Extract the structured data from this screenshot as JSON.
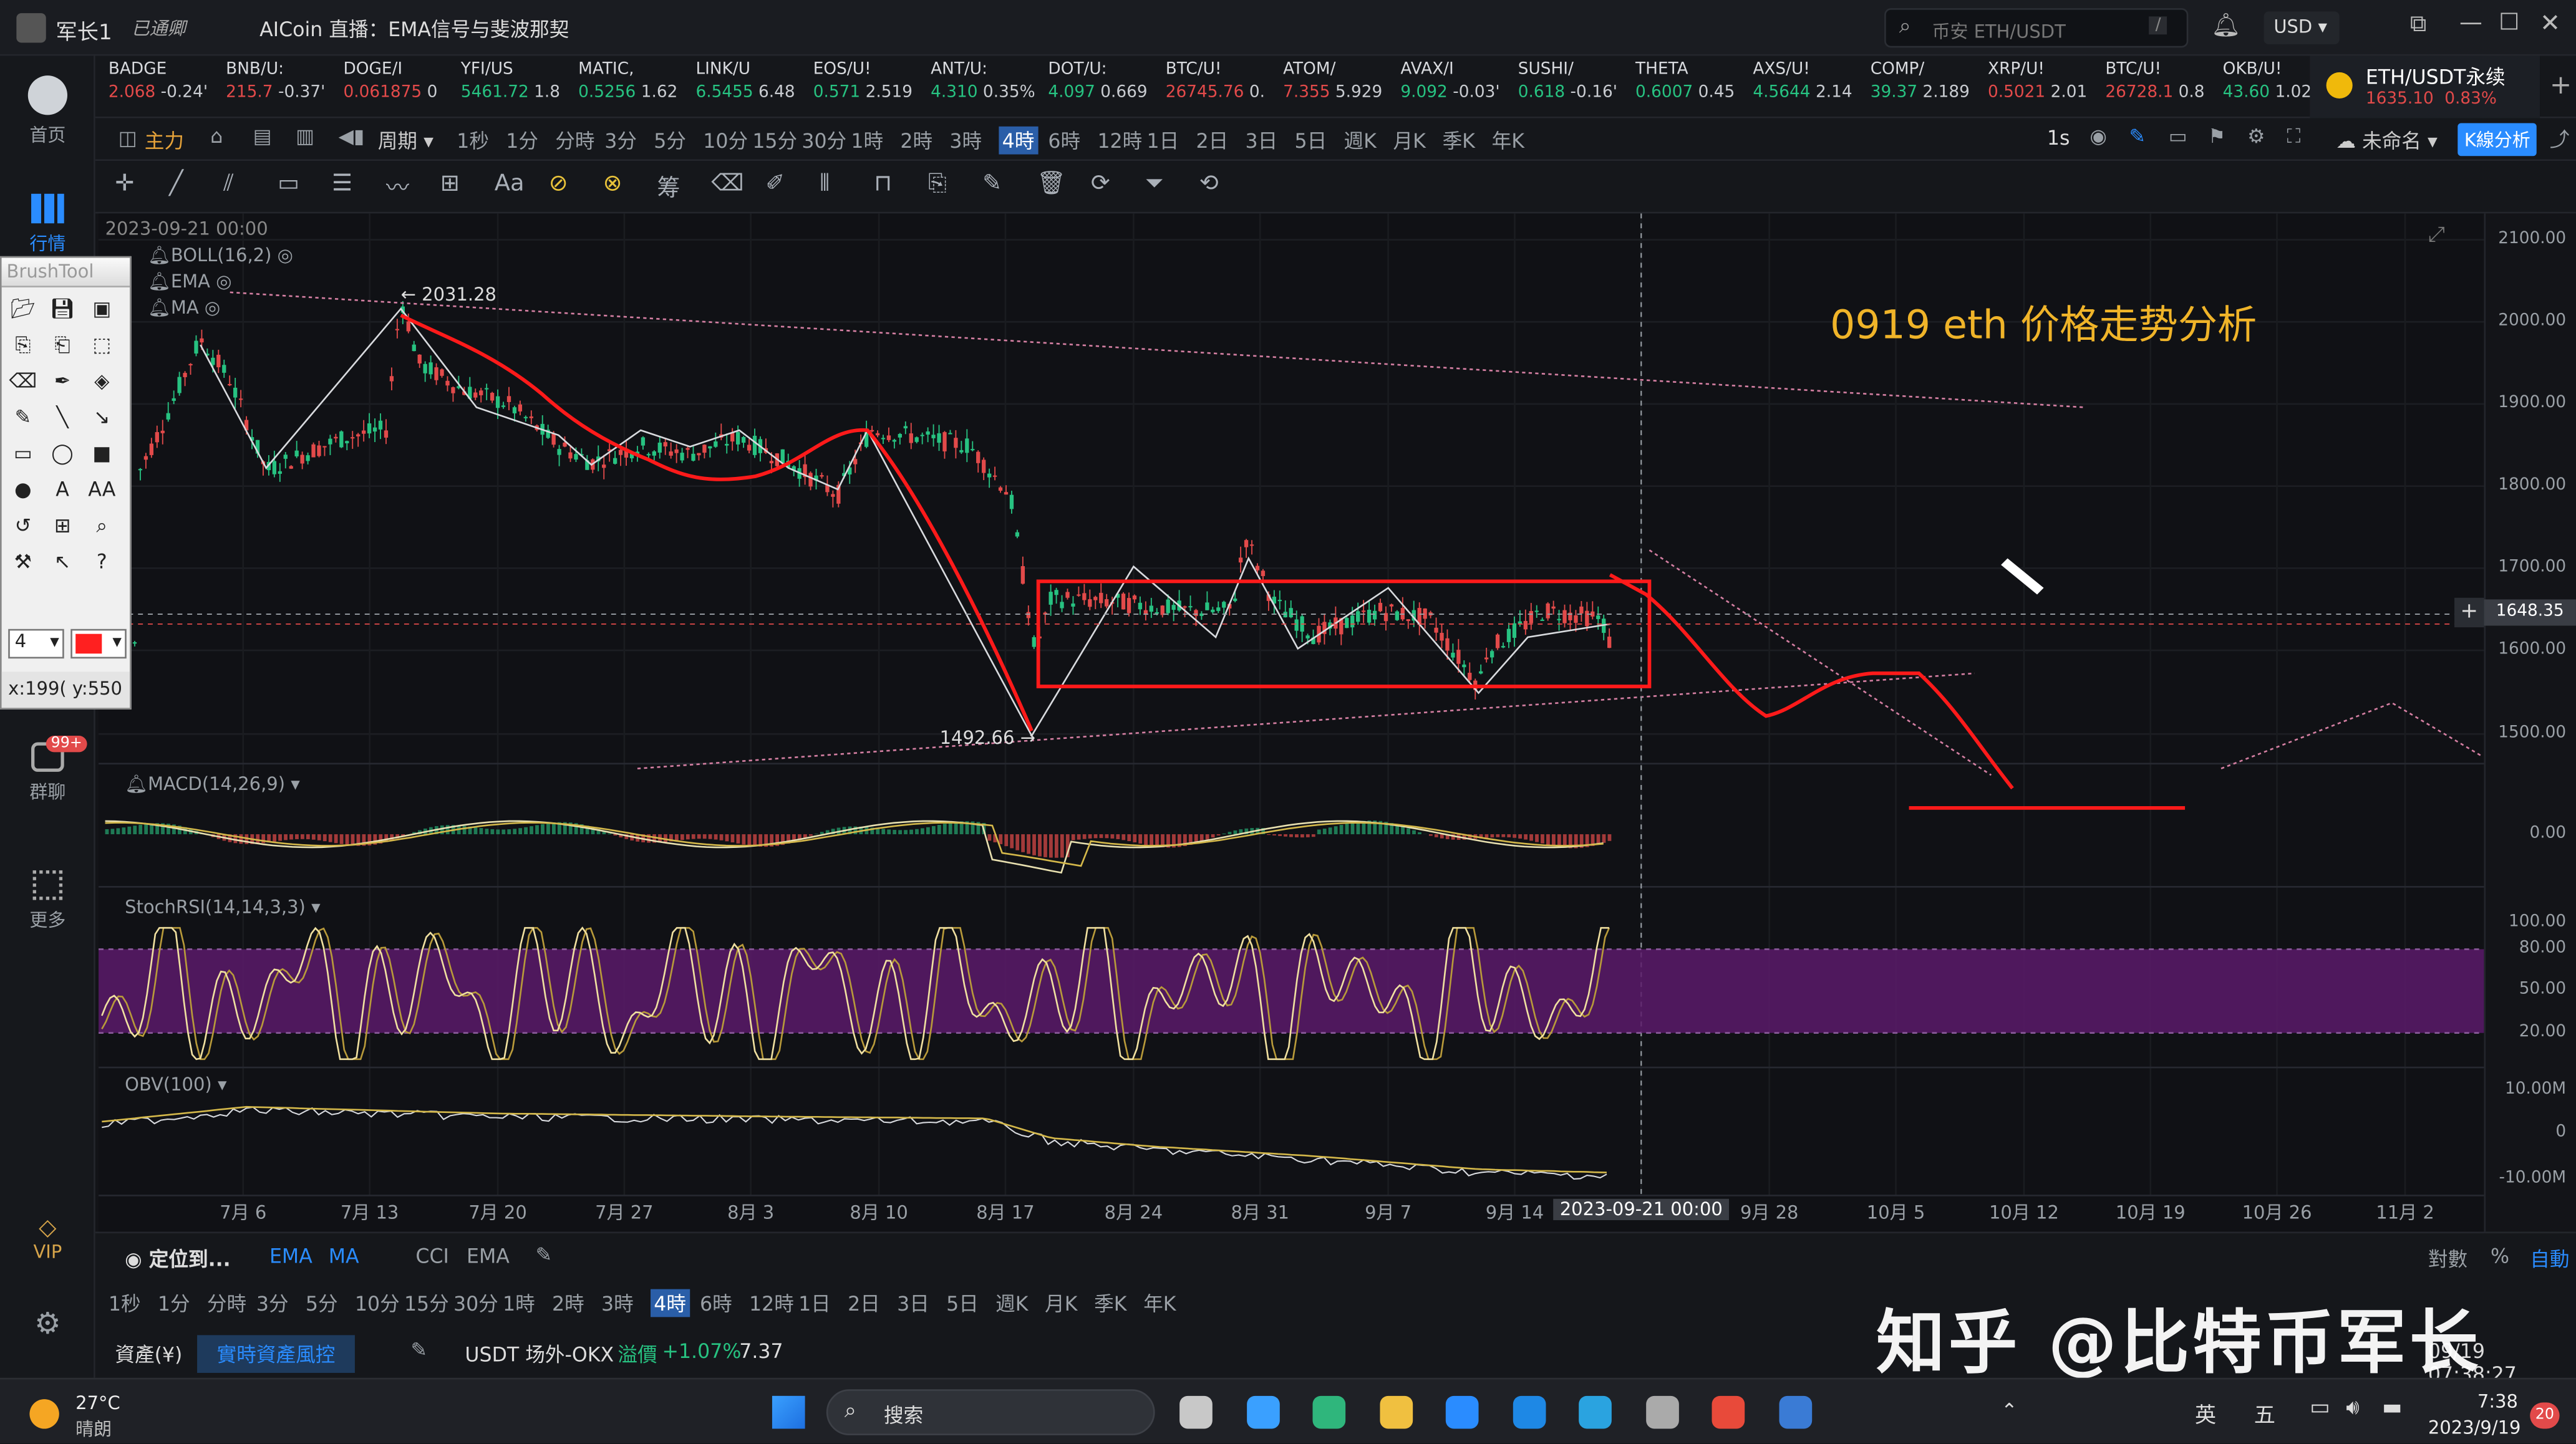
{
  "titlebar": {
    "user": "军长1",
    "badge": "已通卿",
    "app_title": "AICoin 直播：EMA信号与斐波那契",
    "search_placeholder": "币安 ETH/USDT",
    "search_shortcut": "/",
    "currency": "USD"
  },
  "leftnav": {
    "home": "首页",
    "market": "行情",
    "group": "群聊",
    "group_badge": "99+",
    "more": "更多",
    "vip": "VIP"
  },
  "tickers": [
    {
      "name": "BADGE",
      "price": "2.068",
      "chg": "-0.24'",
      "dir": "dn"
    },
    {
      "name": "BNB/U:",
      "price": "215.7",
      "chg": "-0.37'",
      "dir": "dn"
    },
    {
      "name": "DOGE/I",
      "price": "0.061875",
      "chg": "0",
      "dir": "dn"
    },
    {
      "name": "YFI/US",
      "price": "5461.72",
      "chg": "1.8",
      "dir": "up"
    },
    {
      "name": "MATIC,",
      "price": "0.5256",
      "chg": "1.62",
      "dir": "up"
    },
    {
      "name": "LINK/U",
      "price": "6.5455",
      "chg": "6.48",
      "dir": "up"
    },
    {
      "name": "EOS/U!",
      "price": "0.571",
      "chg": "2.519",
      "dir": "up"
    },
    {
      "name": "ANT/U:",
      "price": "4.310",
      "chg": "0.35%",
      "dir": "up"
    },
    {
      "name": "DOT/U:",
      "price": "4.097",
      "chg": "0.669",
      "dir": "up"
    },
    {
      "name": "BTC/U!",
      "price": "26745.76",
      "chg": "0.",
      "dir": "dn"
    },
    {
      "name": "ATOM/",
      "price": "7.355",
      "chg": "5.929",
      "dir": "dn"
    },
    {
      "name": "AVAX/I",
      "price": "9.092",
      "chg": "-0.03'",
      "dir": "up"
    },
    {
      "name": "SUSHI/",
      "price": "0.618",
      "chg": "-0.16'",
      "dir": "up"
    },
    {
      "name": "THETA",
      "price": "0.6007",
      "chg": "0.45",
      "dir": "up"
    },
    {
      "name": "AXS/U!",
      "price": "4.5644",
      "chg": "2.14",
      "dir": "up"
    },
    {
      "name": "COMP/",
      "price": "39.37",
      "chg": "2.189",
      "dir": "up"
    },
    {
      "name": "XRP/U!",
      "price": "0.5021",
      "chg": "2.01",
      "dir": "dn"
    },
    {
      "name": "BTC/U!",
      "price": "26728.1",
      "chg": "0.8",
      "dir": "dn"
    },
    {
      "name": "OKB/U!",
      "price": "43.60",
      "chg": "1.029",
      "dir": "up"
    }
  ],
  "active_pair": {
    "name": "ETH/USDT永续",
    "price": "1635.10",
    "chg": "0.83%"
  },
  "toolbar1": {
    "main": "主力",
    "period": "周期",
    "intervals": [
      "1秒",
      "1分",
      "分時",
      "3分",
      "5分",
      "10分",
      "15分",
      "30分",
      "1時",
      "2時",
      "3時",
      "4時",
      "6時",
      "12時",
      "1日",
      "2日",
      "3日",
      "5日",
      "週K",
      "月K",
      "季K",
      "年K"
    ],
    "active_interval": "4時",
    "right_1s": "1s",
    "unnamed": "未命名",
    "kline_analysis": "K線分析"
  },
  "chart": {
    "date_label": "2023-09-21 00:00",
    "indicators": [
      "BOLL(16,2)",
      "EMA",
      "MA"
    ],
    "title_annotation": "0919 eth 价格走势分析",
    "high_label": "2031.28",
    "low_label": "1492.66",
    "current_price": "1648.35",
    "price_ticks": [
      "2100.00",
      "2000.00",
      "1900.00",
      "1800.00",
      "1700.00",
      "1600.00",
      "1500.00"
    ],
    "macd_label": "MACD(14,26,9)",
    "macd_zero": "0.00",
    "stoch_label": "StochRSI(14,14,3,3)",
    "stoch_ticks": [
      "100.00",
      "80.00",
      "50.00",
      "20.00"
    ],
    "obv_label": "OBV(100)",
    "obv_ticks": [
      "10.00M",
      "0",
      "-10.00M"
    ],
    "dates": [
      "7月 6",
      "7月 13",
      "7月 20",
      "7月 27",
      "8月 3",
      "8月 10",
      "8月 17",
      "8月 24",
      "8月 31",
      "9月 7",
      "9月 14",
      "2023-09-21 00:00",
      "9月 28",
      "10月 5",
      "10月 12",
      "10月 19",
      "10月 26",
      "11月 2"
    ]
  },
  "brushtool": {
    "title": "BrushTool",
    "size": "4",
    "color": "#ff2020",
    "coords": "x:199( y:550"
  },
  "bottom": {
    "locate": "定位到...",
    "ema": "EMA",
    "ma": "MA",
    "cci": "CCI",
    "ema2": "EMA",
    "intervals": [
      "1秒",
      "1分",
      "分時",
      "3分",
      "5分",
      "10分",
      "15分",
      "30分",
      "1時",
      "2時",
      "3時",
      "4時",
      "6時",
      "12時",
      "1日",
      "2日",
      "3日",
      "5日",
      "週K",
      "月K",
      "季K",
      "年K"
    ],
    "right_opts": [
      "對數",
      "%",
      "自動"
    ],
    "assets": "資產(¥)",
    "realtime": "實時資產風控",
    "usdt_label": "USDT 场外-OKX",
    "premium_label": "溢價",
    "premium_value": "+1.07%",
    "premium_price": "7.37",
    "clock": "09/19 07:38:27"
  },
  "taskbar": {
    "temp": "27°C",
    "weather": "晴朗",
    "search": "搜索",
    "lang": "英",
    "day": "五",
    "time": "7:38",
    "date": "2023/9/19",
    "notif": "20"
  },
  "watermark": "知乎 @比特币军长"
}
